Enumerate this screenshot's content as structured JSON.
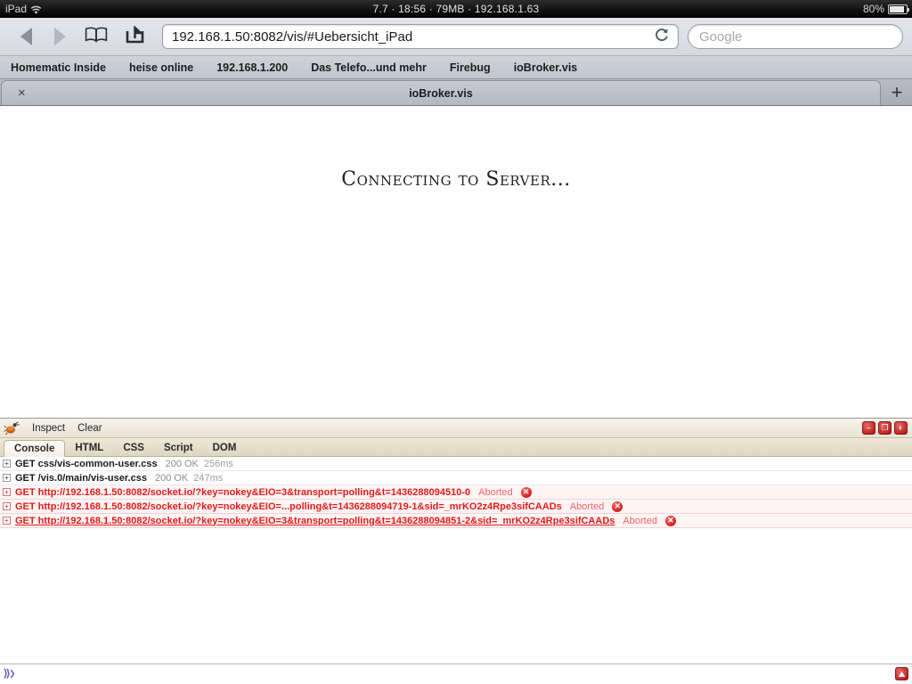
{
  "status_bar": {
    "device": "iPad",
    "wifi_icon": "wifi-icon",
    "center": "7.7 · 18:56 · 79MB · 192.168.1.63",
    "battery_percent": "80%",
    "battery_icon": "battery-icon"
  },
  "toolbar": {
    "back_icon": "back-arrow-icon",
    "forward_icon": "forward-arrow-icon",
    "bookmarks_icon": "book-icon",
    "share_icon": "share-icon",
    "url_value": "192.168.1.50:8082/vis/#Uebersicht_iPad",
    "reload_icon": "reload-icon",
    "search_placeholder": "Google"
  },
  "bookmarks_bar": [
    {
      "label": "Homematic Inside"
    },
    {
      "label": "heise online"
    },
    {
      "label": "192.168.1.200"
    },
    {
      "label": "Das Telefo...und mehr"
    },
    {
      "label": "Firebug"
    },
    {
      "label": "ioBroker.vis"
    }
  ],
  "tab_strip": {
    "close_label": "×",
    "title": "ioBroker.vis",
    "new_tab_label": "+"
  },
  "page": {
    "connecting_message": "Connecting to Server..."
  },
  "firebug": {
    "bug_icon": "firebug-bug-icon",
    "inspect_label": "Inspect",
    "clear_label": "Clear",
    "window_buttons": [
      {
        "name": "minimize-button",
        "glyph": "–"
      },
      {
        "name": "detach-button",
        "glyph": "❐"
      },
      {
        "name": "close-button",
        "glyph": "◐"
      }
    ],
    "tabs": [
      {
        "label": "Console",
        "active": true
      },
      {
        "label": "HTML",
        "active": false
      },
      {
        "label": "CSS",
        "active": false
      },
      {
        "label": "Script",
        "active": false
      },
      {
        "label": "DOM",
        "active": false
      }
    ],
    "console_rows": [
      {
        "method_url": "GET css/vis-common-user.css",
        "status": "200 OK",
        "time": "256ms",
        "error": false,
        "hover": false
      },
      {
        "method_url": "GET /vis.0/main/vis-user.css",
        "status": "200 OK",
        "time": "247ms",
        "error": false,
        "hover": false
      },
      {
        "method_url": "GET http://192.168.1.50:8082/socket.io/?key=nokey&EIO=3&transport=polling&t=1436288094510-0",
        "status": "Aborted",
        "time": "",
        "error": true,
        "hover": false
      },
      {
        "method_url": "GET http://192.168.1.50:8082/socket.io/?key=nokey&EIO=...polling&t=1436288094719-1&sid=_mrKO2z4Rpe3sifCAADs",
        "status": "Aborted",
        "time": "",
        "error": true,
        "hover": false
      },
      {
        "method_url": "GET http://192.168.1.50:8082/socket.io/?key=nokey&EIO=3&transport=polling&t=1436288094851-2&sid=_mrKO2z4Rpe3sifCAADs",
        "status": "Aborted",
        "time": "",
        "error": true,
        "hover": true
      }
    ],
    "command_prompt": "⟫❯",
    "status_badge_icon": "error-badge-icon"
  },
  "colors": {
    "error_red": "#e01b1b",
    "status_grey": "#8d8d8d",
    "chrome_grey": "#c3c7ce",
    "firebug_tan": "#e9e4d4"
  }
}
